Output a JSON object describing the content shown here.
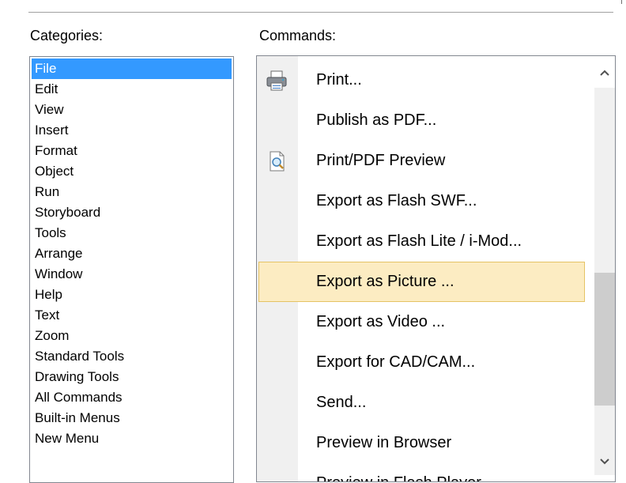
{
  "categories": {
    "label": "Categories:",
    "items": [
      {
        "label": "File",
        "selected": true
      },
      {
        "label": "Edit"
      },
      {
        "label": "View"
      },
      {
        "label": "Insert"
      },
      {
        "label": "Format"
      },
      {
        "label": "Object"
      },
      {
        "label": "Run"
      },
      {
        "label": "Storyboard"
      },
      {
        "label": "Tools"
      },
      {
        "label": "Arrange"
      },
      {
        "label": "Window"
      },
      {
        "label": "Help"
      },
      {
        "label": "Text"
      },
      {
        "label": "Zoom"
      },
      {
        "label": "Standard Tools"
      },
      {
        "label": "Drawing Tools"
      },
      {
        "label": "All Commands"
      },
      {
        "label": "Built-in Menus"
      },
      {
        "label": "New Menu"
      }
    ],
    "selected_color": "#3399ff"
  },
  "commands": {
    "label": "Commands:",
    "items": [
      {
        "label": "Print...",
        "icon": "printer-icon"
      },
      {
        "label": "Publish as PDF..."
      },
      {
        "label": "Print/PDF Preview",
        "icon": "print-preview-icon"
      },
      {
        "label": "Export as Flash SWF..."
      },
      {
        "label": "Export as Flash Lite / i-Mod..."
      },
      {
        "label": "Export as Picture ...",
        "highlighted": true
      },
      {
        "label": "Export as Video ..."
      },
      {
        "label": "Export for CAD/CAM..."
      },
      {
        "label": "Send..."
      },
      {
        "label": "Preview in Browser"
      },
      {
        "label": "Preview in Flash Player"
      }
    ],
    "highlight_color": "#fcecc2",
    "scroll": {
      "up_icon": "chevron-up-icon",
      "down_icon": "chevron-down-icon",
      "up_glyph": "⌃",
      "down_glyph": "⌄"
    }
  }
}
